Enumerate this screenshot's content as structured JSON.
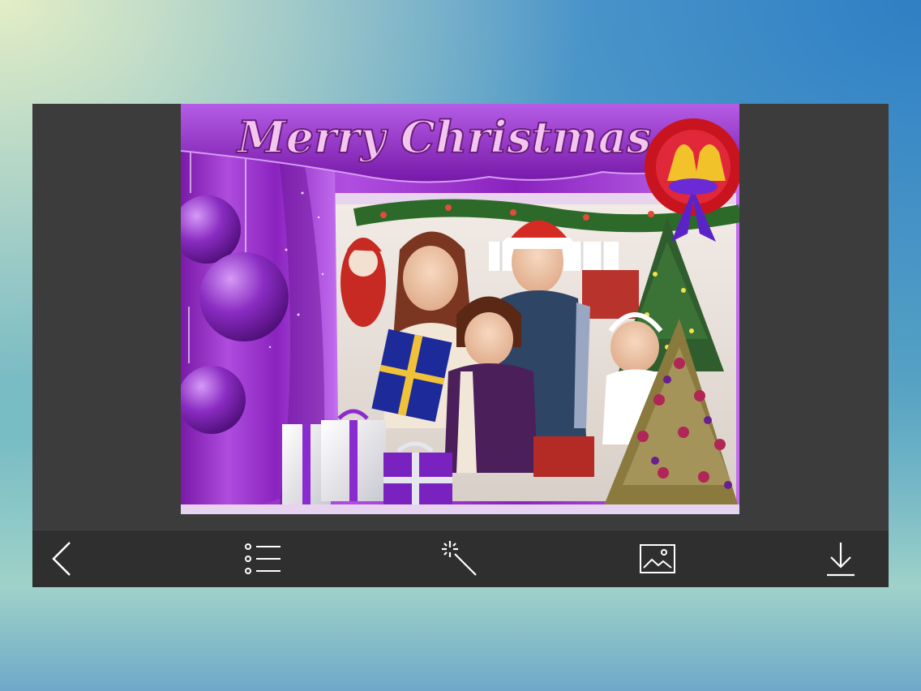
{
  "photo_frame": {
    "title_text": "Merry Christmas",
    "theme_color": "#9a2bd0"
  },
  "toolbar": {
    "buttons": [
      {
        "icon": "back-chevron-icon",
        "action": "back"
      },
      {
        "icon": "list-icon",
        "action": "frames"
      },
      {
        "icon": "magic-wand-icon",
        "action": "effects"
      },
      {
        "icon": "image-icon",
        "action": "gallery"
      },
      {
        "icon": "download-icon",
        "action": "save"
      }
    ],
    "icon_color": "#ffffff",
    "background": "#2f2f2f"
  }
}
